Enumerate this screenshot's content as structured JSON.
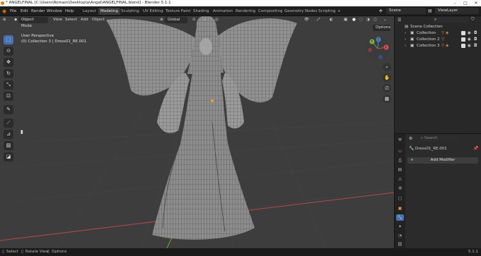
{
  "window": {
    "title": "* ANGELFINAL [C:\\Users\\Romain\\Desktop\\a\\Angel\\ANGELFINAL.blend] - Blender 5.1.1"
  },
  "menu": {
    "items": [
      "File",
      "Edit",
      "Render",
      "Window",
      "Help"
    ],
    "workspaces": [
      "Layout",
      "Modeling",
      "Sculpting",
      "UV Editing",
      "Texture Paint",
      "Shading",
      "Animation",
      "Rendering",
      "Compositing",
      "Geometry Nodes",
      "Scripting"
    ],
    "active_workspace": "Modeling",
    "add_tab": "+",
    "scene_label": "Scene",
    "view_layer_label": "ViewLayer"
  },
  "viewport": {
    "mode": "Object Mode",
    "menus": [
      "View",
      "Select",
      "Add",
      "Object"
    ],
    "transform_orientation": "Global",
    "options_label": "Options",
    "perspective": "User Perspective",
    "context": "(0) Collection 3 | Dress01_RE.001",
    "axes": {
      "x": "X",
      "y": "Y",
      "z": "Z"
    }
  },
  "outliner": {
    "root": "Scene Collection",
    "collections": [
      "Collection",
      "Collection 2",
      "Collection 3"
    ]
  },
  "properties": {
    "search_placeholder": "Search",
    "object_name": "Dress01_RE.001",
    "add_modifier": "Add Modifier"
  },
  "statusbar": {
    "items": [
      "Select",
      "Rotate View",
      "Options"
    ],
    "version": "5.1.1"
  },
  "colors": {
    "accent": "#4772b3",
    "viewport_bg": "#3d3d3d",
    "grid_x_axis": "#b84848",
    "grid_y_axis": "#7aa33b"
  }
}
